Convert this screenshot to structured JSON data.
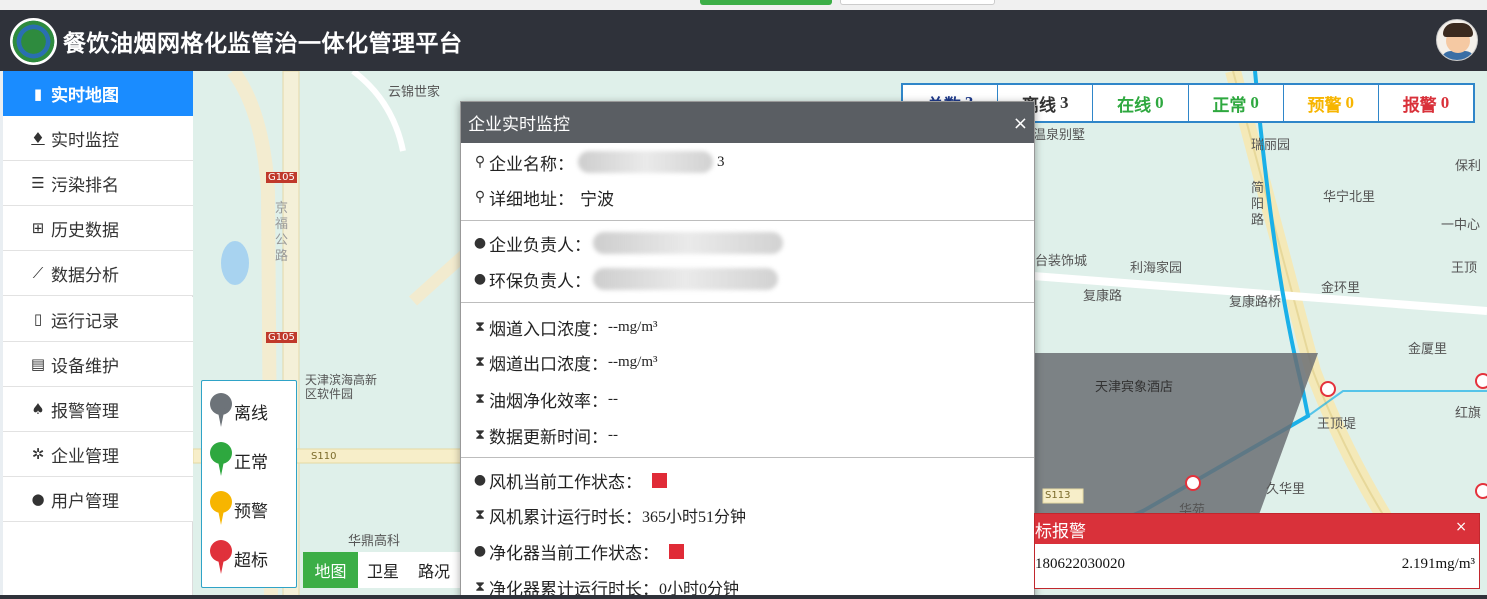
{
  "app": {
    "title": "餐饮油烟网格化监管治一体化管理平台"
  },
  "sidebar": {
    "items": [
      {
        "label": "实时地图",
        "icon": "map-icon",
        "active": true
      },
      {
        "label": "实时监控",
        "icon": "fire-icon"
      },
      {
        "label": "污染排名",
        "icon": "list-icon"
      },
      {
        "label": "历史数据",
        "icon": "table-icon"
      },
      {
        "label": "数据分析",
        "icon": "line-chart-icon"
      },
      {
        "label": "运行记录",
        "icon": "file-icon"
      },
      {
        "label": "设备维护",
        "icon": "document-icon"
      },
      {
        "label": "报警管理",
        "icon": "bell-icon"
      },
      {
        "label": "企业管理",
        "icon": "gear-icon"
      },
      {
        "label": "用户管理",
        "icon": "user-icon"
      }
    ]
  },
  "map": {
    "labels": {
      "yunjin": "云锦世家",
      "g105a": "G105",
      "g105b": "G105",
      "jingfu": "京福公路",
      "binhai": "天津滨海高新区软件园",
      "s110": "S110",
      "huading": "华鼎高科",
      "huaning": "华宁北里",
      "jianyang": "简阳路",
      "baoli": "保利",
      "zhongxin": "一中心",
      "zhuangshi": "台装饰城",
      "lihai": "利海家园",
      "fukang": "复康路",
      "fukangqiao": "复康路桥",
      "jinhuan": "金环里",
      "wangding": "王顶",
      "jinxia": "金厦里",
      "jinyu": "天津宾象酒店",
      "hongqi": "红旗",
      "wangdingdi": "王顶堤",
      "jiuhua": "久华里",
      "s113": "S113",
      "huayuan": "华苑",
      "jinquan": "温泉别墅",
      "tianli": "瑞丽园"
    },
    "types": [
      "地图",
      "卫星",
      "路况"
    ],
    "active_type": "地图"
  },
  "legend": [
    {
      "label": "离线",
      "color": "#6d7379"
    },
    {
      "label": "正常",
      "color": "#2ea83f"
    },
    {
      "label": "预警",
      "color": "#f7b500"
    },
    {
      "label": "超标",
      "color": "#e0313b"
    }
  ],
  "stats": [
    {
      "label": "总数",
      "value": "3",
      "color": "#1f3b8c"
    },
    {
      "label": "离线",
      "value": "3",
      "color": "#333333"
    },
    {
      "label": "在线",
      "value": "0",
      "color": "#2ea83f"
    },
    {
      "label": "正常",
      "value": "0",
      "color": "#2ea83f"
    },
    {
      "label": "预警",
      "value": "0",
      "color": "#f7b500"
    },
    {
      "label": "报警",
      "value": "0",
      "color": "#d9313a"
    }
  ],
  "modal": {
    "title": "企业实时监控",
    "close": "×",
    "company_name_label": "企业名称：",
    "company_name_suffix": "3",
    "address_label": "详细地址：",
    "address_value": "宁波",
    "owner_label": "企业负责人：",
    "env_owner_label": "环保负责人：",
    "inlet_label": "烟道入口浓度：",
    "inlet_value": "--mg/m³",
    "outlet_label": "烟道出口浓度：",
    "outlet_value": "--mg/m³",
    "efficiency_label": "油烟净化效率：",
    "efficiency_value": "--",
    "update_label": "数据更新时间：",
    "update_value": "--",
    "fan_status_label": "风机当前工作状态：",
    "fan_runtime_label": "风机累计运行时长：",
    "fan_runtime_value": "365小时51分钟",
    "purifier_status_label": "净化器当前工作状态：",
    "purifier_runtime_label": "净化器累计运行时长：",
    "purifier_runtime_value": "0小时0分钟"
  },
  "alarm": {
    "title": "标报警",
    "close": "×",
    "device_id": "180622030020",
    "value": "2.191mg/m³"
  }
}
